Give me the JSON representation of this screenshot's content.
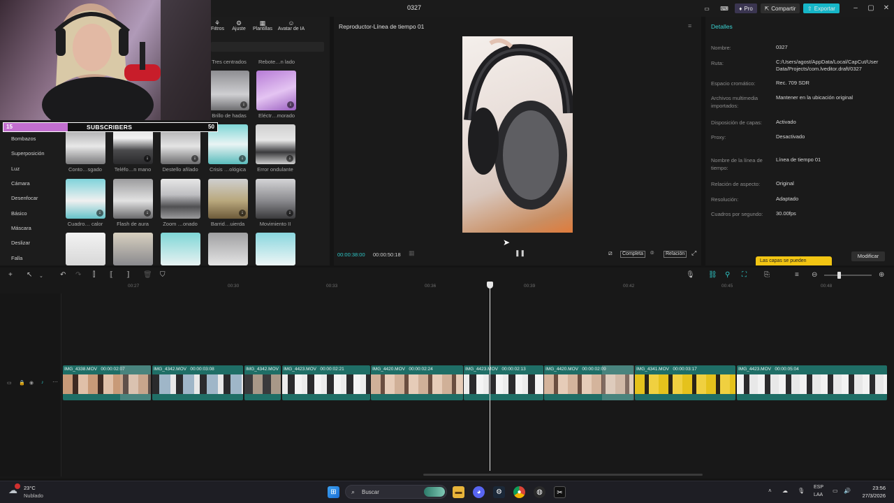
{
  "window": {
    "title": "0327",
    "pro_label": "Pro",
    "share_label": "Compartir",
    "export_label": "Exportar",
    "accent_color": "#16b6c8"
  },
  "effects_toolbar": {
    "items": [
      {
        "label": "Filtros",
        "icon": "filters-icon"
      },
      {
        "label": "Ajuste",
        "icon": "adjust-icon"
      },
      {
        "label": "Plantillas",
        "icon": "templates-icon"
      },
      {
        "label": "Avatar de IA",
        "icon": "ai-avatar-icon"
      }
    ]
  },
  "effects_categories": [
    "Bombazos",
    "Superposición",
    "Luz",
    "Cámara",
    "Desenfocar",
    "Básico",
    "Máscara",
    "Deslizar",
    "Falla"
  ],
  "effects_grid": {
    "row0": [
      "Tres centrados",
      "Rebote…n lado"
    ],
    "row1": [
      "Brillo de hadas",
      "Eléctr…morado"
    ],
    "row2": [
      "Conto…sgado",
      "Teléfo…n mano",
      "Destello afilado",
      "Crisis …ológica",
      "Error ondulante"
    ],
    "row3": [
      "Cuadro… calor",
      "Flash de aura",
      "Zoom …onado",
      "Barrid…uierda",
      "Movimiento II"
    ]
  },
  "overlay": {
    "subs_current": "15",
    "subs_label": "SUBSCRIBERS",
    "subs_goal": "50"
  },
  "player": {
    "title": "Reproductor-Línea de tiempo 01",
    "current_time": "00:00:38:00",
    "total_time": "00:00:50:18",
    "full_label": "Completa",
    "ratio_label": "Relación"
  },
  "details": {
    "tab": "Detalles",
    "rows": [
      {
        "key": "Nombre:",
        "value": "0327"
      },
      {
        "key": "Ruta:",
        "value": "C:/Users/agost/AppData/Local/CapCut/User Data/Projects/com.lveditor.draft/0327"
      },
      {
        "key": "Espacio cromático:",
        "value": "Rec. 709 SDR"
      },
      {
        "key": "Archivos multimedia importados:",
        "value": "Mantener en la ubicación original"
      },
      {
        "key": "Disposición de capas:",
        "value": "Activado"
      },
      {
        "key": "Proxy:",
        "value": "Desactivado"
      },
      {
        "key": "Nombre de la línea de tiempo:",
        "value": "Línea de tiempo 01"
      },
      {
        "key": "Relación de aspecto:",
        "value": "Original"
      },
      {
        "key": "Resolución:",
        "value": "Adaptado"
      },
      {
        "key": "Cuadros por segundo:",
        "value": "30.00fps"
      }
    ],
    "tooltip": "Las capas se pueden",
    "modify_label": "Modificar"
  },
  "timeline": {
    "ruler": [
      "00:27",
      "00:30",
      "00:33",
      "00:36",
      "00:39",
      "00:42",
      "00:45",
      "00:48"
    ],
    "clips": [
      {
        "name": "IMG_4338.MOV",
        "duration": "00:00:02:07",
        "tone": "warm"
      },
      {
        "name": "IMG_4342.MOV",
        "duration": "00:00:03:08",
        "tone": "cool"
      },
      {
        "name": "IMG_4342.MOV",
        "duration": "",
        "tone": "mixed"
      },
      {
        "name": "IMG_4423.MOV",
        "duration": "00:00:02:21",
        "tone": "white"
      },
      {
        "name": "IMG_4420.MOV",
        "duration": "00:00:02:24",
        "tone": "warm"
      },
      {
        "name": "IMG_4423.MOV",
        "duration": "00:00:02:13",
        "tone": "white"
      },
      {
        "name": "IMG_4420.MOV",
        "duration": "00:00:02:09",
        "tone": "warm"
      },
      {
        "name": "IMG_4341.MOV",
        "duration": "00:00:03:17",
        "tone": "yellow"
      },
      {
        "name": "IMG_4423.MOV",
        "duration": "00:00:05:04",
        "tone": "white"
      }
    ]
  },
  "taskbar": {
    "weather_temp": "23°C",
    "weather_desc": "Nublado",
    "search_placeholder": "Buscar",
    "lang_top": "ESP",
    "lang_bottom": "LAA",
    "time": "23:56",
    "date": "27/3/2026"
  }
}
